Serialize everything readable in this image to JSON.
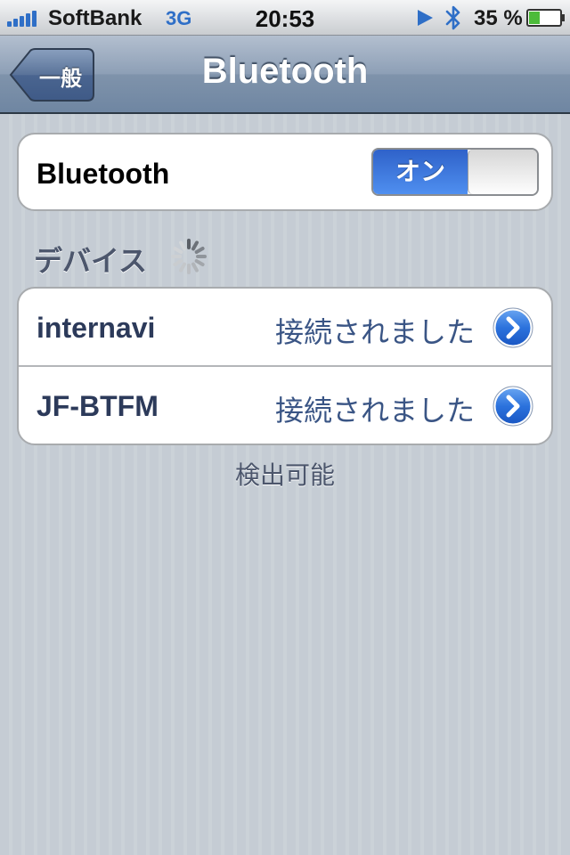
{
  "status_bar": {
    "carrier": "SoftBank",
    "network": "3G",
    "time": "20:53",
    "battery_percent": "35 %",
    "battery_level": 0.35,
    "accent_color": "#2f6fc7"
  },
  "nav": {
    "back_label": "一般",
    "title": "Bluetooth"
  },
  "bluetooth": {
    "label": "Bluetooth",
    "toggle_label": "オン",
    "toggle_state": "on",
    "toggle_color": "#3b78e0"
  },
  "devices": {
    "header": "デバイス",
    "searching": true,
    "items": [
      {
        "name": "internavi",
        "status": "接続されました"
      },
      {
        "name": "JF-BTFM",
        "status": "接続されました"
      }
    ]
  },
  "footer": {
    "text": "検出可能"
  }
}
